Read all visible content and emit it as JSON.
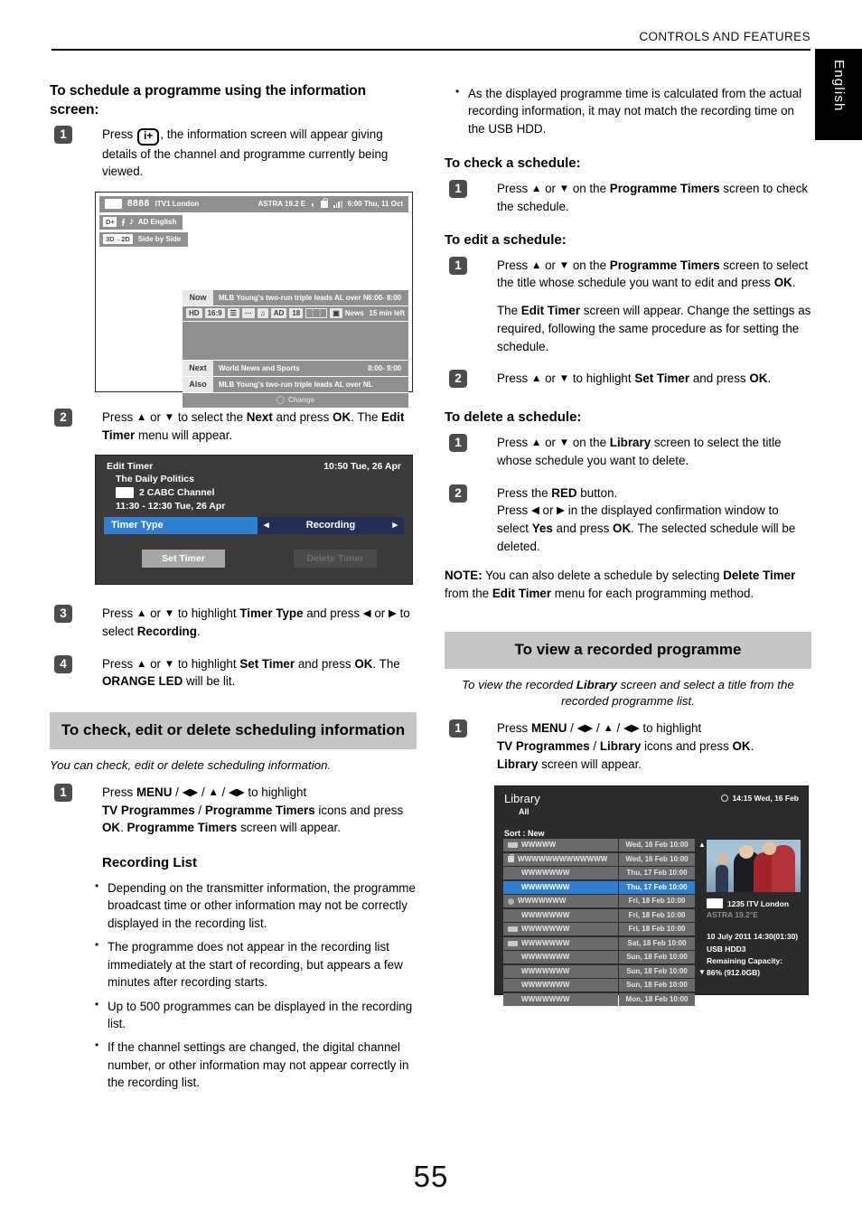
{
  "header": {
    "running_title": "CONTROLS AND FEATURES",
    "language_tab": "English",
    "page_number": "55"
  },
  "left_column": {
    "heading_schedule": "To schedule a programme using the information screen:",
    "step1": {
      "number": "1",
      "text_before": "Press",
      "keycap": "i+",
      "text_after": ", the information screen will appear giving details of the channel and programme currently being viewed."
    },
    "step2": {
      "number": "2",
      "text": "Press ▲ or ▼ to select the Next and press OK. The Edit Timer menu will appear."
    },
    "step3": {
      "number": "3",
      "text": "Press ▲ or ▼ to highlight Timer Type and press ◀ or ▶ to select Recording."
    },
    "step4": {
      "number": "4",
      "text": "Press ▲ or ▼ to highlight Set Timer and press OK. The ORANGE LED will be lit."
    },
    "banner_check_edit_delete": "To check, edit or delete scheduling information",
    "intro_check_edit_delete": "You can check, edit or delete scheduling information.",
    "step_menu": {
      "number": "1",
      "text": "Press MENU / ◀▶ / ▲ / ◀▶ to highlight TV Programmes / Programme Timers icons and press OK. Programme Timers screen will appear."
    },
    "recording_list_heading": "Recording List",
    "recording_list_bullets": [
      "Depending on the transmitter information, the programme broadcast time or other information may not be correctly displayed in the recording list.",
      "The programme does not appear in the recording list immediately at the start of recording, but appears a few minutes after recording starts.",
      "Up to 500 programmes can be displayed in the recording list.",
      "If the channel settings are changed, the digital channel number, or other information may not appear correctly in the recording list."
    ]
  },
  "right_column": {
    "top_bullet": "As the displayed programme time is calculated from the actual recording information, it may not match the recording time on the USB HDD.",
    "heading_check": "To check a schedule:",
    "check_step1": {
      "number": "1",
      "text": "Press ▲ or ▼ on the Programme Timers screen to check the schedule."
    },
    "heading_edit": "To edit a schedule:",
    "edit_step1": {
      "number": "1",
      "text": "Press ▲ or ▼ on the Programme Timers screen to select the title whose schedule you want to edit and press OK."
    },
    "edit_step1_para": "The Edit Timer screen will appear. Change the settings as required, following the same procedure as for setting the schedule.",
    "edit_step2": {
      "number": "2",
      "text": "Press ▲ or ▼ to highlight Set Timer and press OK."
    },
    "heading_delete": "To delete a schedule:",
    "delete_step1": {
      "number": "1",
      "text": "Press ▲ or ▼ on the Library screen to select the title whose schedule you want to delete."
    },
    "delete_step2": {
      "number": "2",
      "line1": "Press the RED button.",
      "line2": "Press ◀ or ▶ in the displayed confirmation window to select Yes and press OK. The selected schedule will be deleted."
    },
    "note": "NOTE: You can also delete a schedule by selecting Delete Timer from the Edit Timer menu for each programming method.",
    "banner_view_recorded": "To view a recorded programme",
    "intro_view_recorded": "To view the recorded Library screen and select a title from the recorded programme list.",
    "view_step1": {
      "number": "1",
      "text": "Press MENU / ◀▶ / ▲ / ◀▶ to highlight TV Programmes / Library icons and press OK. Library screen will appear."
    }
  },
  "info_screen": {
    "channel_number": "8888",
    "channel_name": "ITV1 London",
    "satellite": "ASTRA 19.2 E",
    "clock": "6:00 Thu, 11 Oct",
    "audio_chip": "D+",
    "audio_label": "AD English",
    "chip_3d": "3D→2D",
    "mode_3d": "Side by Side",
    "now_tag": "Now",
    "now_title": "MLB Young's two-run triple leads AL over NL",
    "now_time": "6:00- 8:00",
    "icons": [
      "HD",
      "16:9",
      "subtitle-icon",
      "teletext-icon",
      "audio-icon",
      "AD",
      "18",
      "widescreen-icon",
      "genre-icon"
    ],
    "genre_label": "News",
    "time_left": "15 min left",
    "next_tag": "Next",
    "next_title": "World News and Sports",
    "next_time": "8:00- 9:00",
    "also_tag": "Also",
    "also_title": "MLB Young's two-run triple leads AL over NL",
    "footer_action": "Change"
  },
  "edit_timer": {
    "title": "Edit Timer",
    "clock": "10:50 Tue, 26 Apr",
    "programme": "The Daily Politics",
    "channel": "2 CABC Channel",
    "time_range": "11:30 - 12:30 Tue, 26 Apr",
    "row_label": "Timer Type",
    "row_value": "Recording",
    "set_button": "Set Timer",
    "delete_button": "Delete Timer",
    "accent_blue": "#2f7fd2"
  },
  "library": {
    "title": "Library",
    "filter": "All",
    "clock": "14:15 Wed, 16 Feb",
    "sort": "Sort : New",
    "rows": [
      {
        "badge": "tv-icon",
        "name": "WWWWW",
        "date": "Wed, 16 Feb 10:00",
        "selected": false
      },
      {
        "badge": "lock-icon",
        "name": "WWWWWWWWWWWWW",
        "date": "Wed, 16 Feb 10:00",
        "selected": false
      },
      {
        "badge": "none",
        "name": "WWWWWWW",
        "date": "Thu, 17 Feb 10:00",
        "selected": false
      },
      {
        "badge": "none",
        "name": "WWWWWWW",
        "date": "Thu, 17 Feb 10:00",
        "selected": true
      },
      {
        "badge": "dot-icon",
        "name": "WWWWWWW",
        "date": "Fri, 18 Feb 10:00",
        "selected": false
      },
      {
        "badge": "none",
        "name": "WWWWWWW",
        "date": "Fri, 18 Feb 10:00",
        "selected": false
      },
      {
        "badge": "tv-icon",
        "name": "WWWWWWW",
        "date": "Fri, 18 Feb 10:00",
        "selected": false
      },
      {
        "badge": "tv-icon",
        "name": "WWWWWWW",
        "date": "Sat, 18 Feb 10:00",
        "selected": false
      },
      {
        "badge": "none",
        "name": "WWWWWWW",
        "date": "Sun, 18 Feb 10:00",
        "selected": false
      },
      {
        "badge": "none",
        "name": "WWWWWWW",
        "date": "Sun, 18 Feb 10:00",
        "selected": false
      },
      {
        "badge": "none",
        "name": "WWWWWWW",
        "date": "Sun, 18 Feb 10:00",
        "selected": false
      },
      {
        "badge": "none",
        "name": "WWWWWWW",
        "date": "Mon, 18 Feb 10:00",
        "selected": false
      }
    ],
    "scroll_up": "▲",
    "scroll_down": "▼",
    "detail_channel": "1235 ITV London",
    "detail_satellite": "ASTRA 19.2°E",
    "detail_datetime": "10 July 2011  14:30(01:30)",
    "detail_device": "USB HDD3",
    "detail_capacity_label": "Remaining Capacity:",
    "detail_capacity_value": "86% (912.0GB)",
    "accent_blue": "#2f7fd2"
  }
}
